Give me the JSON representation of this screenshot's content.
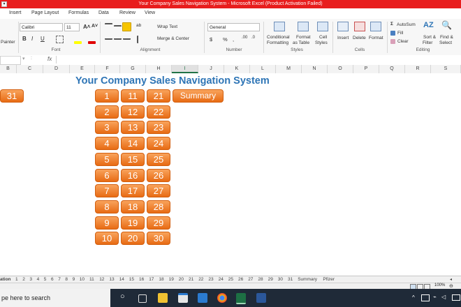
{
  "window": {
    "title": "Your Company Sales Navigation System  -  Microsoft Excel (Product Activation Failed)",
    "title_color": "#e81d1d"
  },
  "menu": {
    "items": [
      "Insert",
      "Page Layout",
      "Formulas",
      "Data",
      "Review",
      "View"
    ]
  },
  "ribbon": {
    "clipboard": {
      "painter_label": "Painter"
    },
    "font": {
      "name": "Calibri",
      "size": "11",
      "grow": "A˄",
      "shrink": "A˅",
      "bold": "B",
      "italic": "I",
      "underline": "U",
      "group_label": "Font"
    },
    "alignment": {
      "wrap_text": "Wrap Text",
      "merge_center": "Merge & Center",
      "group_label": "Alignment"
    },
    "number": {
      "format": "General",
      "currency": "$",
      "percent": "%",
      "comma": ",",
      "group_label": "Number"
    },
    "styles": {
      "conditional": "Conditional",
      "conditional2": "Formatting",
      "format_as": "Format",
      "format_as2": "as Table",
      "cell": "Cell",
      "cell2": "Styles",
      "group_label": "Styles"
    },
    "cells": {
      "insert": "Insert",
      "delete": "Delete",
      "format": "Format",
      "group_label": "Cells"
    },
    "editing": {
      "autosum": "AutoSum",
      "fill": "Fill",
      "clear": "Clear",
      "sort": "Sort &",
      "sort2": "Filter",
      "find": "Find &",
      "find2": "Select",
      "group_label": "Editing"
    }
  },
  "formula_bar": {
    "fx": "fx",
    "value": ""
  },
  "columns": [
    "B",
    "C",
    "D",
    "E",
    "F",
    "G",
    "H",
    "I",
    "J",
    "K",
    "L",
    "M",
    "N",
    "O",
    "P",
    "Q",
    "R",
    "S"
  ],
  "selected_column": "I",
  "sheet": {
    "title": "Your Company Sales Navigation System",
    "title_color": "#2e75b6",
    "button_color": "#f28a34",
    "summary_label": "Summary",
    "day_buttons": [
      "1",
      "2",
      "3",
      "4",
      "5",
      "6",
      "7",
      "8",
      "9",
      "10",
      "11",
      "12",
      "13",
      "14",
      "15",
      "16",
      "17",
      "18",
      "19",
      "20",
      "21",
      "22",
      "23",
      "24",
      "25",
      "26",
      "27",
      "28",
      "29",
      "30",
      "31"
    ]
  },
  "tabs": {
    "first_partial": "ation",
    "items": [
      "1",
      "2",
      "3",
      "4",
      "5",
      "6",
      "7",
      "8",
      "9",
      "10",
      "11",
      "12",
      "13",
      "14",
      "15",
      "16",
      "17",
      "18",
      "19",
      "20",
      "21",
      "22",
      "23",
      "24",
      "25",
      "26",
      "27",
      "28",
      "29",
      "30",
      "31",
      "Summary",
      "Pfizer"
    ]
  },
  "status": {
    "zoom": "100%"
  },
  "taskbar": {
    "search_placeholder": "pe here to search",
    "icons": [
      "windows-icon",
      "task-view-icon",
      "file-explorer-icon",
      "store-icon",
      "mail-icon",
      "chrome-icon",
      "excel-icon",
      "word-icon"
    ],
    "tray": "^"
  }
}
